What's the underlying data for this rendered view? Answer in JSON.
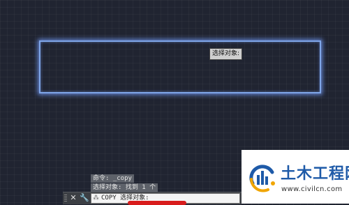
{
  "drawing": {
    "tooltip": "选择对象:"
  },
  "command_history": [
    "命令: _copy",
    "选择对象: 找到 1 个"
  ],
  "command_line": {
    "close_icon": "close-icon",
    "customize_icon": "wrench-icon",
    "prompt_icon": "command-prompt-icon",
    "text": "COPY 选择对象:"
  },
  "watermark": {
    "title": "土木工程网",
    "url": "www.civilcn.com"
  },
  "colors": {
    "background": "#202431",
    "selection_rectangle": "#7fa6e8",
    "brand_blue": "#1e5aa8",
    "highlight_mark": "#d81c1c"
  }
}
